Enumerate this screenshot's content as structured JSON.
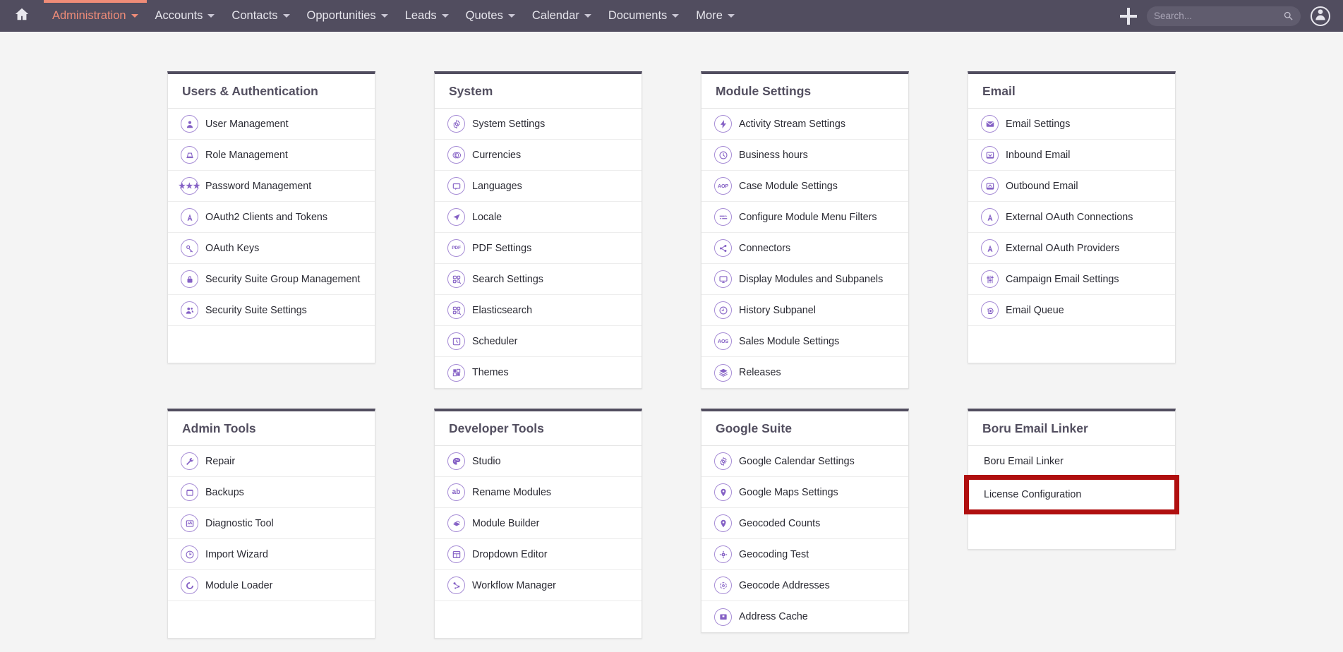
{
  "navbar": {
    "home_icon": "home-icon",
    "items": [
      {
        "label": "Administration",
        "active": true,
        "caret": true
      },
      {
        "label": "Accounts",
        "active": false,
        "caret": true
      },
      {
        "label": "Contacts",
        "active": false,
        "caret": true
      },
      {
        "label": "Opportunities",
        "active": false,
        "caret": true
      },
      {
        "label": "Leads",
        "active": false,
        "caret": true
      },
      {
        "label": "Quotes",
        "active": false,
        "caret": true
      },
      {
        "label": "Calendar",
        "active": false,
        "caret": true
      },
      {
        "label": "Documents",
        "active": false,
        "caret": true
      },
      {
        "label": "More",
        "active": false,
        "caret": true
      }
    ],
    "plus_label": "+",
    "search": {
      "value": "",
      "placeholder": "Search..."
    },
    "avatar_icon": "user-avatar-icon"
  },
  "colors": {
    "navbar_bg": "#514d5f",
    "active_tab": "#ef8c78",
    "panel_header_border": "#514d5f",
    "icon_purple": "#8561c5",
    "highlight_red": "#b00f0f",
    "page_bg": "#f4f4f4"
  },
  "panels": [
    {
      "title": "Users & Authentication",
      "has_icons": true,
      "trailing_spacer": true,
      "items": [
        {
          "label": "User Management",
          "icon": "user-icon"
        },
        {
          "label": "Role Management",
          "icon": "role-hat-icon"
        },
        {
          "label": "Password Management",
          "icon": "password-dots-icon"
        },
        {
          "label": "OAuth2 Clients and Tokens",
          "icon": "oauth-a-icon"
        },
        {
          "label": "OAuth Keys",
          "icon": "key-icon"
        },
        {
          "label": "Security Suite Group Management",
          "icon": "lock-icon"
        },
        {
          "label": "Security Suite Settings",
          "icon": "users-group-icon"
        }
      ]
    },
    {
      "title": "System",
      "has_icons": true,
      "trailing_spacer": false,
      "items": [
        {
          "label": "System Settings",
          "icon": "gear-icon"
        },
        {
          "label": "Currencies",
          "icon": "currency-icon"
        },
        {
          "label": "Languages",
          "icon": "speech-bubble-icon"
        },
        {
          "label": "Locale",
          "icon": "navigation-arrow-icon"
        },
        {
          "label": "PDF Settings",
          "icon": "pdf-icon"
        },
        {
          "label": "Search Settings",
          "icon": "search-modules-icon"
        },
        {
          "label": "Elasticsearch",
          "icon": "search-modules-icon"
        },
        {
          "label": "Scheduler",
          "icon": "clock-square-icon"
        },
        {
          "label": "Themes",
          "icon": "themes-squares-icon"
        }
      ]
    },
    {
      "title": "Module Settings",
      "has_icons": true,
      "trailing_spacer": false,
      "items": [
        {
          "label": "Activity Stream Settings",
          "icon": "lightning-icon"
        },
        {
          "label": "Business hours",
          "icon": "clock-icon"
        },
        {
          "label": "Case Module Settings",
          "icon": "aop-icon"
        },
        {
          "label": "Configure Module Menu Filters",
          "icon": "sliders-icon"
        },
        {
          "label": "Connectors",
          "icon": "connectors-icon"
        },
        {
          "label": "Display Modules and Subpanels",
          "icon": "monitor-icon"
        },
        {
          "label": "History Subpanel",
          "icon": "history-icon"
        },
        {
          "label": "Sales Module Settings",
          "icon": "aos-icon"
        },
        {
          "label": "Releases",
          "icon": "layers-icon"
        }
      ]
    },
    {
      "title": "Email",
      "has_icons": true,
      "trailing_spacer": true,
      "items": [
        {
          "label": "Email Settings",
          "icon": "envelope-icon"
        },
        {
          "label": "Inbound Email",
          "icon": "inbound-email-icon"
        },
        {
          "label": "Outbound Email",
          "icon": "outbound-email-icon"
        },
        {
          "label": "External OAuth Connections",
          "icon": "oauth-a-icon"
        },
        {
          "label": "External OAuth Providers",
          "icon": "oauth-a-icon"
        },
        {
          "label": "Campaign Email Settings",
          "icon": "equalizer-icon"
        },
        {
          "label": "Email Queue",
          "icon": "snail-icon"
        }
      ]
    },
    {
      "title": "Admin Tools",
      "has_icons": true,
      "trailing_spacer": true,
      "items": [
        {
          "label": "Repair",
          "icon": "wrench-icon"
        },
        {
          "label": "Backups",
          "icon": "backup-box-icon"
        },
        {
          "label": "Diagnostic Tool",
          "icon": "diagnostic-chart-icon"
        },
        {
          "label": "Import Wizard",
          "icon": "import-icon"
        },
        {
          "label": "Module Loader",
          "icon": "module-loader-icon"
        }
      ]
    },
    {
      "title": "Developer Tools",
      "has_icons": true,
      "trailing_spacer": true,
      "items": [
        {
          "label": "Studio",
          "icon": "palette-icon"
        },
        {
          "label": "Rename Modules",
          "icon": "ab-icon"
        },
        {
          "label": "Module Builder",
          "icon": "module-builder-icon"
        },
        {
          "label": "Dropdown Editor",
          "icon": "layout-icon"
        },
        {
          "label": "Workflow Manager",
          "icon": "workflow-icon"
        }
      ]
    },
    {
      "title": "Google Suite",
      "has_icons": true,
      "trailing_spacer": false,
      "items": [
        {
          "label": "Google Calendar Settings",
          "icon": "gear-icon"
        },
        {
          "label": "Google Maps Settings",
          "icon": "map-pin-icon"
        },
        {
          "label": "Geocoded Counts",
          "icon": "map-pin-icon"
        },
        {
          "label": "Geocoding Test",
          "icon": "geocoding-test-icon"
        },
        {
          "label": "Geocode Addresses",
          "icon": "target-icon"
        },
        {
          "label": "Address Cache",
          "icon": "archive-icon"
        }
      ]
    },
    {
      "title": "Boru Email Linker",
      "has_icons": false,
      "trailing_spacer": true,
      "items": [
        {
          "label": "Boru Email Linker",
          "icon": null,
          "highlighted": false
        },
        {
          "label": "License Configuration",
          "icon": null,
          "highlighted": true
        }
      ]
    }
  ]
}
